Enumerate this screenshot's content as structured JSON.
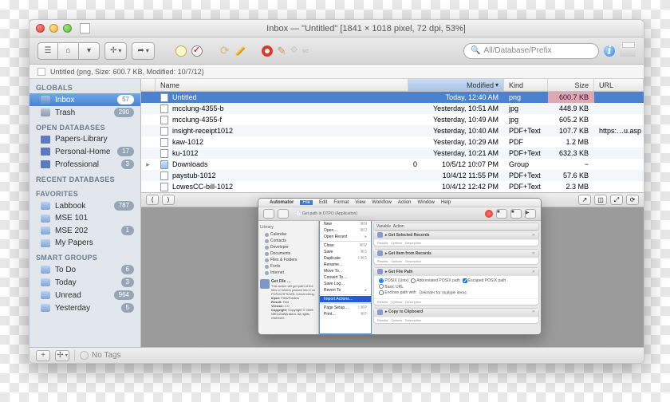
{
  "window": {
    "title": "Inbox — \"Untitled\" [1841 × 1018 pixel, 72 dpi, 53%]"
  },
  "toolbar": {
    "search_placeholder": "All/Database/Prefix"
  },
  "pathbar": {
    "text": "Untitled (png, Size: 600.7 KB, Modified: 10/7/12)"
  },
  "sidebar": {
    "groups": [
      {
        "title": "GLOBALS",
        "items": [
          {
            "icon": "box",
            "label": "Inbox",
            "badge": "57",
            "selected": true
          },
          {
            "icon": "trash",
            "label": "Trash",
            "badge": "290"
          }
        ]
      },
      {
        "title": "OPEN DATABASES",
        "items": [
          {
            "icon": "db",
            "label": "Papers-Library"
          },
          {
            "icon": "db",
            "label": "Personal-Home",
            "badge": "17"
          },
          {
            "icon": "db",
            "label": "Professional",
            "badge": "3"
          }
        ]
      },
      {
        "title": "RECENT DATABASES",
        "items": []
      },
      {
        "title": "FAVORITES",
        "items": [
          {
            "icon": "folder",
            "label": "Labbook",
            "badge": "787"
          },
          {
            "icon": "folder",
            "label": "MSE 101"
          },
          {
            "icon": "folder",
            "label": "MSE 202",
            "badge": "1"
          },
          {
            "icon": "folder",
            "label": "My Papers"
          }
        ]
      },
      {
        "title": "SMART GROUPS",
        "items": [
          {
            "icon": "folder",
            "label": "To Do",
            "badge": "6"
          },
          {
            "icon": "folder",
            "label": "Today",
            "badge": "3"
          },
          {
            "icon": "folder",
            "label": "Unread",
            "badge": "964"
          },
          {
            "icon": "folder",
            "label": "Yesterday",
            "badge": "5"
          }
        ]
      }
    ]
  },
  "table": {
    "headers": {
      "name": "Name",
      "modified": "Modified",
      "kind": "Kind",
      "size": "Size",
      "url": "URL"
    },
    "rows": [
      {
        "icon": "file",
        "name": "Untitled",
        "modified": "Today, 12:40 AM",
        "kind": "png",
        "size": "600.7 KB",
        "url": "",
        "selected": true
      },
      {
        "icon": "file",
        "name": "mcclung-4355-b",
        "modified": "Yesterday, 10:51 AM",
        "kind": "jpg",
        "size": "448.9 KB",
        "url": ""
      },
      {
        "icon": "file",
        "name": "mcclung-4355-f",
        "modified": "Yesterday, 10:49 AM",
        "kind": "jpg",
        "size": "605.2 KB",
        "url": ""
      },
      {
        "icon": "file",
        "name": "insight-receipt1012",
        "modified": "Yesterday, 10:40 AM",
        "kind": "PDF+Text",
        "size": "107.7 KB",
        "url": "https:…u.asp"
      },
      {
        "icon": "file",
        "name": "kaw-1012",
        "modified": "Yesterday, 10:29 AM",
        "kind": "PDF",
        "size": "1.2 MB",
        "url": ""
      },
      {
        "icon": "file",
        "name": "ku-1012",
        "modified": "Yesterday, 10:21 AM",
        "kind": "PDF+Text",
        "size": "632.3 KB",
        "url": ""
      },
      {
        "icon": "folder",
        "name": "Downloads",
        "modified": "10/5/12 10:07 PM",
        "kind": "Group",
        "size": "−",
        "url": "",
        "count": "0",
        "expandable": true
      },
      {
        "icon": "file",
        "name": "paystub-1012",
        "modified": "10/4/12 11:55 PM",
        "kind": "PDF+Text",
        "size": "57.6 KB",
        "url": ""
      },
      {
        "icon": "file",
        "name": "LowesCC-bill-1012",
        "modified": "10/4/12 12:42 PM",
        "kind": "PDF+Text",
        "size": "2.3 MB",
        "url": ""
      }
    ]
  },
  "bottombar": {
    "tags_label": "No Tags"
  },
  "automator": {
    "menu": [
      "Automator",
      "File",
      "Edit",
      "Format",
      "View",
      "Workflow",
      "Action",
      "Window",
      "Help"
    ],
    "active_menu": "File",
    "doc_title": "Get path in DTPO (Application)",
    "dropdown": [
      {
        "t": "New",
        "k": "⌘N"
      },
      {
        "t": "Open…",
        "k": "⌘O"
      },
      {
        "t": "Open Recent",
        "k": "▸"
      },
      {
        "t": "sep"
      },
      {
        "t": "Close",
        "k": "⌘W"
      },
      {
        "t": "Save",
        "k": "⌘S"
      },
      {
        "t": "Duplicate",
        "k": "⇧⌘S"
      },
      {
        "t": "Rename…"
      },
      {
        "t": "Move To…"
      },
      {
        "t": "Convert To…"
      },
      {
        "t": "Save Log…"
      },
      {
        "t": "Revert To",
        "k": "▸"
      },
      {
        "t": "sep"
      },
      {
        "t": "Import Actions…",
        "hl": true
      },
      {
        "t": "sep"
      },
      {
        "t": "Page Setup…",
        "k": "⇧⌘P"
      },
      {
        "t": "Print…",
        "k": "⌘P"
      }
    ],
    "library": {
      "hd1": "Library",
      "items": [
        "Calendar",
        "Contacts",
        "Developer",
        "Documents",
        "Files & Folders",
        "Fonts",
        "Internet"
      ]
    },
    "info": {
      "title": "Get File …",
      "desc": "This action will get path of the files or folders passed into it on POSIX/HFS/URL format string.",
      "input": "Files/Folders",
      "result": "Text",
      "version": "1.0",
      "copyright": "Copyright © 2009 NIKOZAWA Akira. All rights reserved."
    },
    "actions": [
      {
        "title": "Get Selected Records"
      },
      {
        "title": "Get Item from Records"
      },
      {
        "title": "Get File Path",
        "body": {
          "o1": "POSIX (Unix)",
          "o2": "Abbreviated POSIX path",
          "o3": "Escaped POSIX path",
          "o4": "Basic URL",
          "chk": "Enclose path with",
          "dlm": "Delimiter for multiple items:"
        }
      },
      {
        "title": "Copy to Clipboard"
      }
    ],
    "footer": [
      "Results",
      "Options",
      "Description"
    ]
  }
}
